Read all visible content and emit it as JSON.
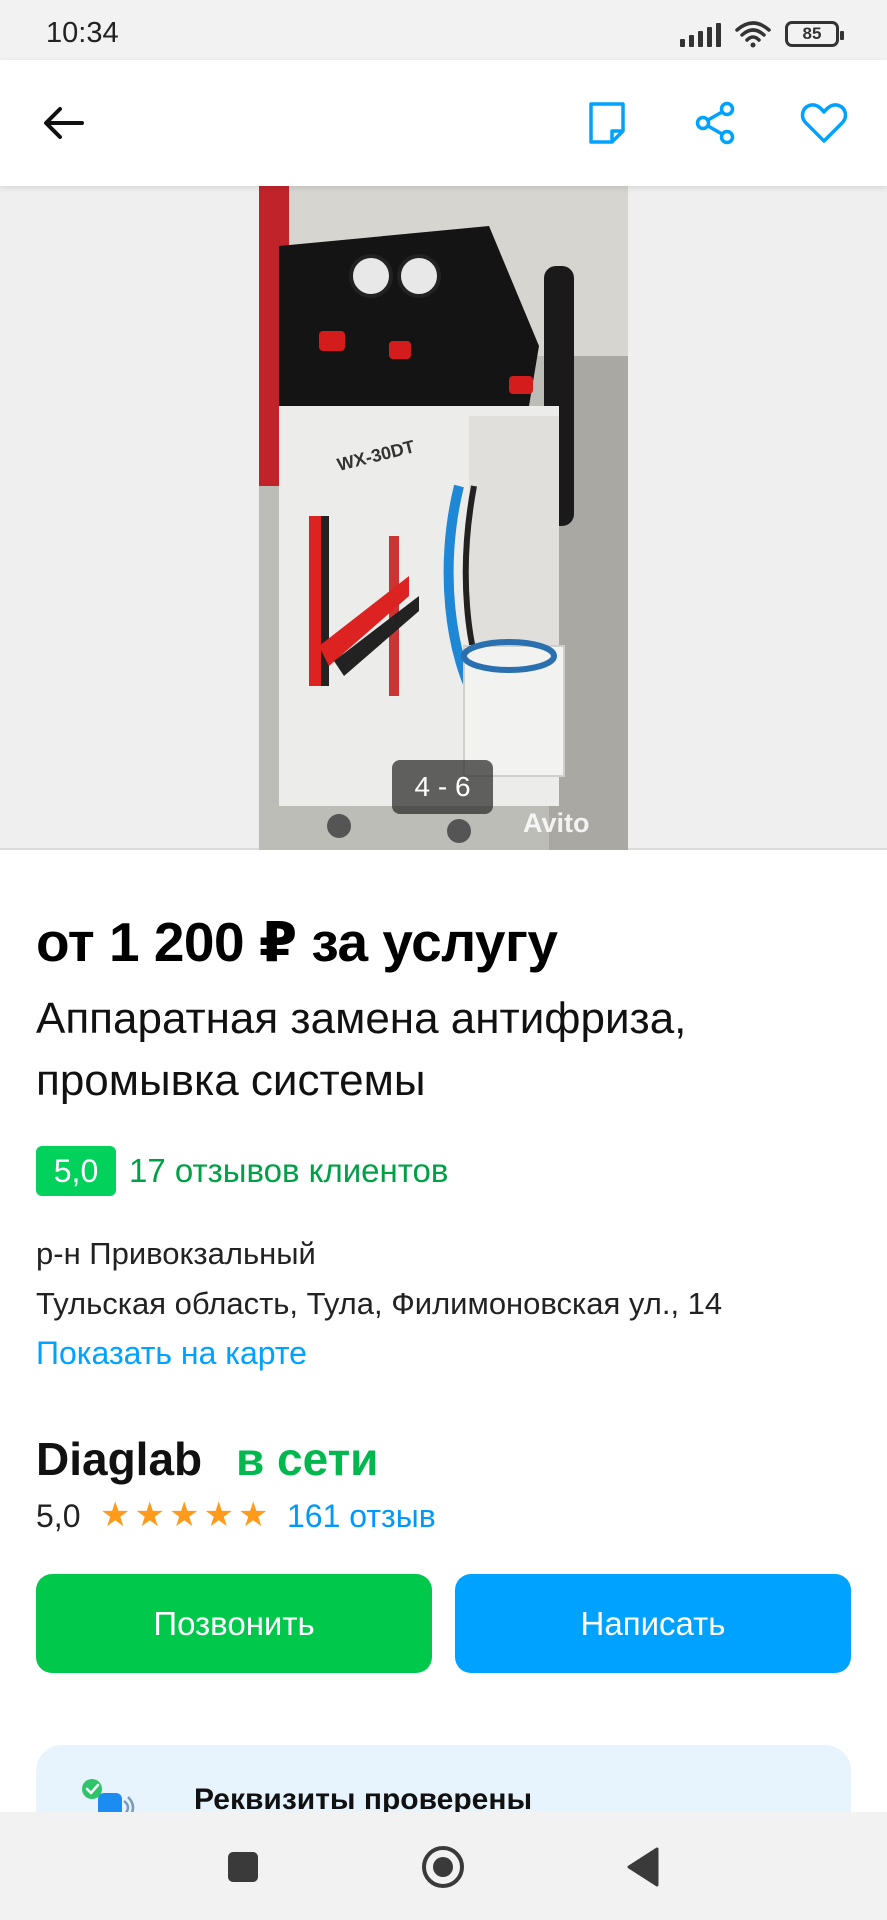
{
  "status_bar": {
    "time": "10:34",
    "battery": "85",
    "icons": [
      "signal-icon",
      "wifi-icon",
      "battery-icon"
    ]
  },
  "app_bar": {
    "icons": [
      "back-arrow-icon",
      "note-icon",
      "share-icon",
      "heart-icon"
    ],
    "accent_color": "#00a2ff"
  },
  "gallery": {
    "counter": "4 - 6",
    "watermark": "Avito",
    "photo_label": "WX-30DT"
  },
  "listing": {
    "price": "от 1 200 ₽ за услугу",
    "title": "Аппаратная замена антифриза, промывка системы",
    "rating": "5,0",
    "reviews_link": "17 отзывов клиентов",
    "district": "р-н Привокзальный",
    "address": "Тульская область, Тула, Филимоновская ул., 14",
    "map_link": "Показать на карте"
  },
  "seller": {
    "name": "Diaglab",
    "status": "в сети",
    "rating": "5,0",
    "stars": 5,
    "reviews": "161 отзыв"
  },
  "actions": {
    "call_label": "Позвонить",
    "write_label": "Написать",
    "call_color": "#00c84b",
    "write_color": "#00a2ff"
  },
  "verified": {
    "label": "Реквизиты проверены"
  },
  "nav_bar": {
    "icons": [
      "recent-apps-icon",
      "home-icon",
      "back-icon"
    ]
  }
}
